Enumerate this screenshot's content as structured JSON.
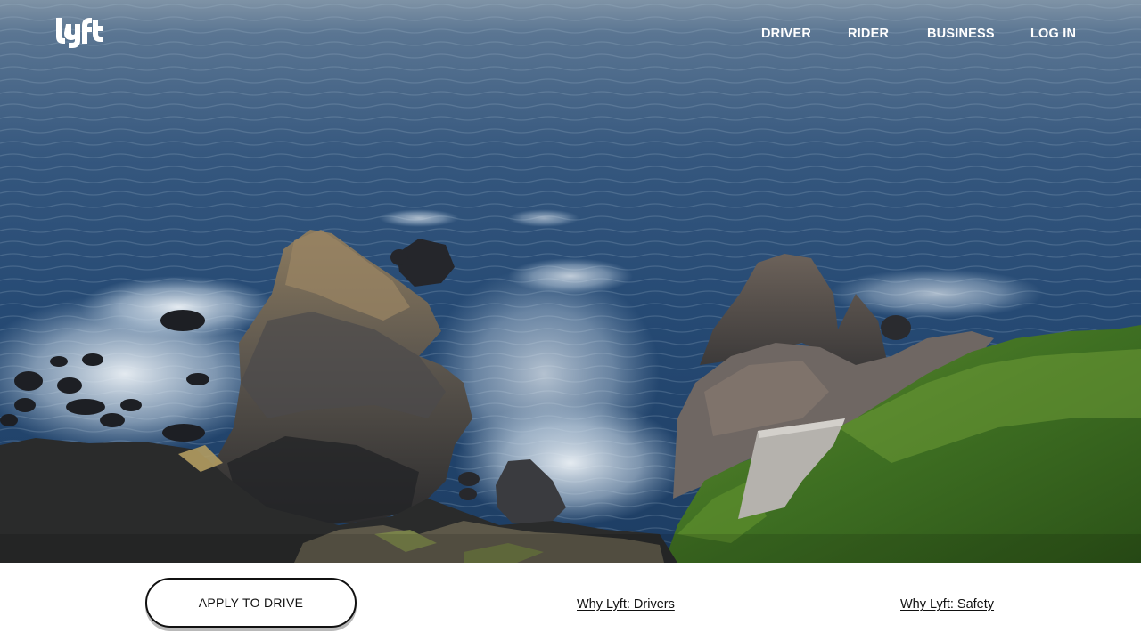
{
  "brand": {
    "logo_text": "lyft",
    "logo_icon": "lyft-logo-icon"
  },
  "nav": {
    "items": [
      {
        "label": "DRIVER"
      },
      {
        "label": "RIDER"
      },
      {
        "label": "BUSINESS"
      },
      {
        "label": "LOG IN"
      }
    ]
  },
  "hero": {
    "image": "ocean-cliffs-aerial-photo"
  },
  "bottom": {
    "cta_label": "APPLY TO DRIVE",
    "links": [
      {
        "label": "Why Lyft: Drivers"
      },
      {
        "label": "Why Lyft: Safety"
      }
    ]
  },
  "colors": {
    "nav_text": "#ffffff",
    "cta_border": "#111111",
    "cta_shadow": "#b9b9b9",
    "ocean": "#2d4a6b"
  }
}
